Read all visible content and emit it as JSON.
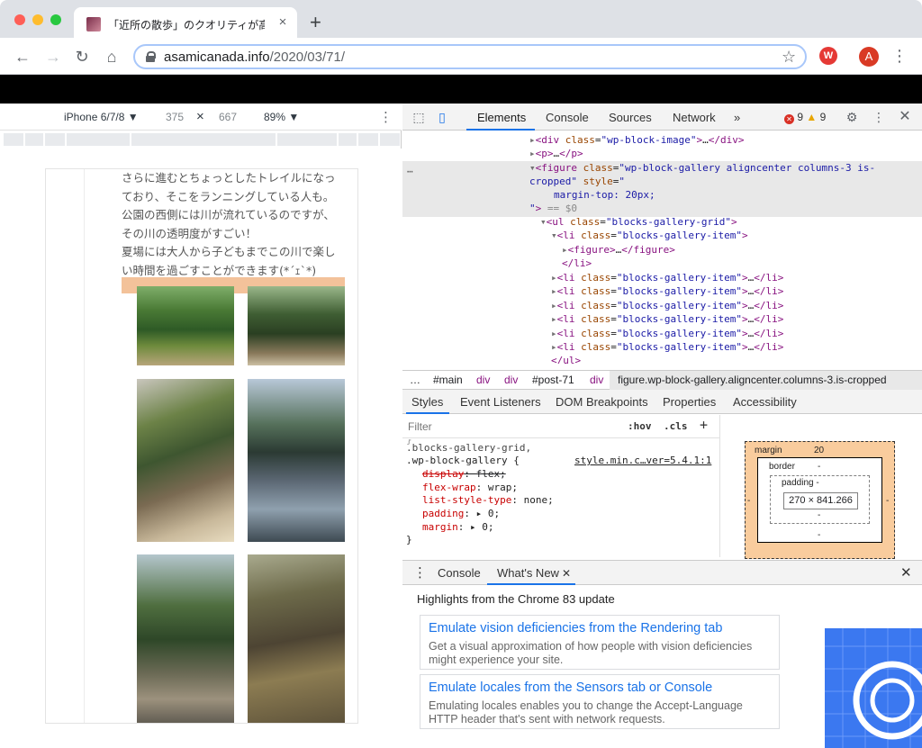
{
  "browser": {
    "tab_title": "「近所の散歩」のクオリティが高",
    "tab_close": "×",
    "new_tab": "+",
    "url_host": "asamicanada.info",
    "url_path": "/2020/03/71/",
    "avatar_letter": "A",
    "extension_label": "W"
  },
  "device_toolbar": {
    "device": "iPhone 6/7/8 ▼",
    "width": "375",
    "times": "×",
    "height": "667",
    "zoom": "89% ▼",
    "more": "⋮"
  },
  "page": {
    "paragraph_lines": [
      "さらに進むとちょっとしたトレイルになっ",
      "ており、そこをランニングしている人も。",
      "公園の西側には川が流れているのですが、",
      "その川の透明度がすごい！",
      "夏場には大人から子どもまでこの川で楽し",
      "い時間を過ごすことができます(*´ｪ`*)"
    ]
  },
  "devtools": {
    "tabs": [
      "Elements",
      "Console",
      "Sources",
      "Network"
    ],
    "more_tabs": "»",
    "errors": "9",
    "warnings": "9",
    "breadcrumbs": [
      "…",
      "#main",
      "div",
      "div",
      "#post-71",
      "div",
      "figure.wp-block-gallery.aligncenter.columns-3.is-cropped"
    ],
    "styles_tabs": [
      "Styles",
      "Event Listeners",
      "DOM Breakpoints",
      "Properties",
      "Accessibility"
    ],
    "filter_placeholder": "Filter",
    "hov": ":hov",
    "cls": ".cls",
    "add_rule": "+",
    "rule_source": "style.min.c…ver=5.4.1:1",
    "box_model": {
      "margin_label": "margin",
      "margin_top": "20",
      "border_label": "border",
      "border_value": "-",
      "padding_label": "padding -",
      "content": "270 × 841.266",
      "dash": "-"
    },
    "drawer_tabs": [
      "Console",
      "What's New"
    ],
    "drawer_heading": "Highlights from the Chrome 83 update",
    "cards": [
      {
        "title": "Emulate vision deficiencies from the Rendering tab",
        "desc": "Get a visual approximation of how people with vision deficiencies might experience your site."
      },
      {
        "title": "Emulate locales from the Sensors tab or Console",
        "desc": "Emulating locales enables you to change the Accept-Language HTTP header that's sent with network requests."
      }
    ]
  }
}
